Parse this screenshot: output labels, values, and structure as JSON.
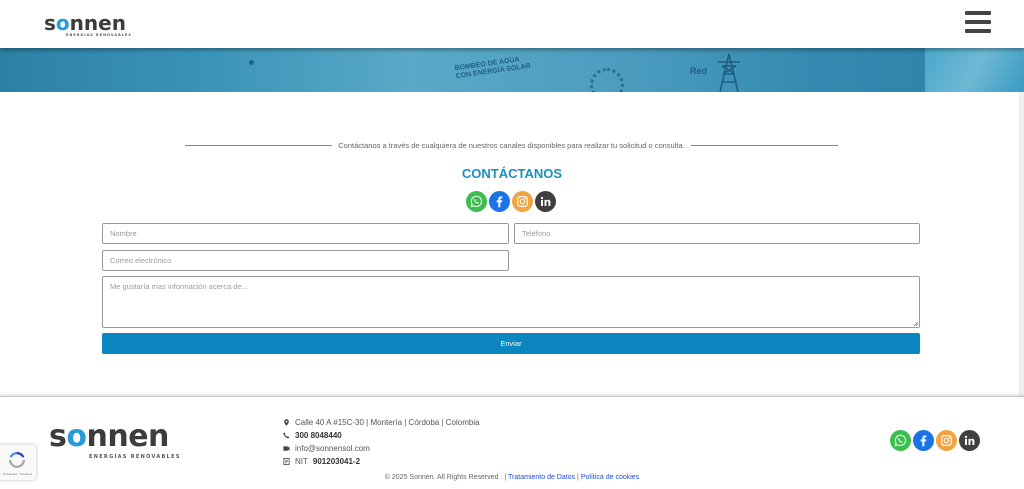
{
  "header": {
    "logo_text_a": "s",
    "logo_text_o": "o",
    "logo_text_b": "nnen",
    "logo_sub": "ENERGÍAS RENOVABLES",
    "menu_icon": "hamburger-icon"
  },
  "banner": {
    "text_line1": "BOMBEO DE AGUA",
    "text_line2": "CON ENERGÍA SOLAR",
    "red_label": "Red"
  },
  "contact": {
    "intro": "Contáctanos a través de cualquiera de nuestros canales disponibles para realizar tu solicitud o consulta.",
    "title": "CONTÁCTANOS",
    "social_icons": [
      "whatsapp-icon",
      "facebook-icon",
      "instagram-icon",
      "linkedin-icon"
    ],
    "name_placeholder": "Nombre",
    "phone_placeholder": "Teléfono",
    "email_placeholder": "Correo electrónico",
    "message_placeholder": "Me gustaría mas información acerca de...",
    "submit_label": "Enviar"
  },
  "footer": {
    "logo_text_a": "s",
    "logo_text_o": "o",
    "logo_text_b": "nnen",
    "logo_sub": "ENERGÍAS RENOVABLES",
    "address": "Calle 40 A #15C-30 | Montería | Córdoba | Colombia",
    "phone": "300 8048440",
    "email": "info@sonnensol.com",
    "nit_label": "NIT",
    "nit_value": "901203041-2",
    "copyright": "© 2025 Sonnen. All Rights Reserved .",
    "link_datos": "Tratamiento de Datos",
    "link_cookies": "Política de cookies",
    "separator": "|"
  },
  "recaptcha": {
    "text": "Privacidad - Términos"
  },
  "colors": {
    "accent": "#1a8ec0",
    "button": "#0b86bf",
    "whatsapp": "#3ebd4f",
    "facebook": "#1b74e4",
    "instagram": "#f0a443",
    "linkedin": "#3f3f3f"
  }
}
